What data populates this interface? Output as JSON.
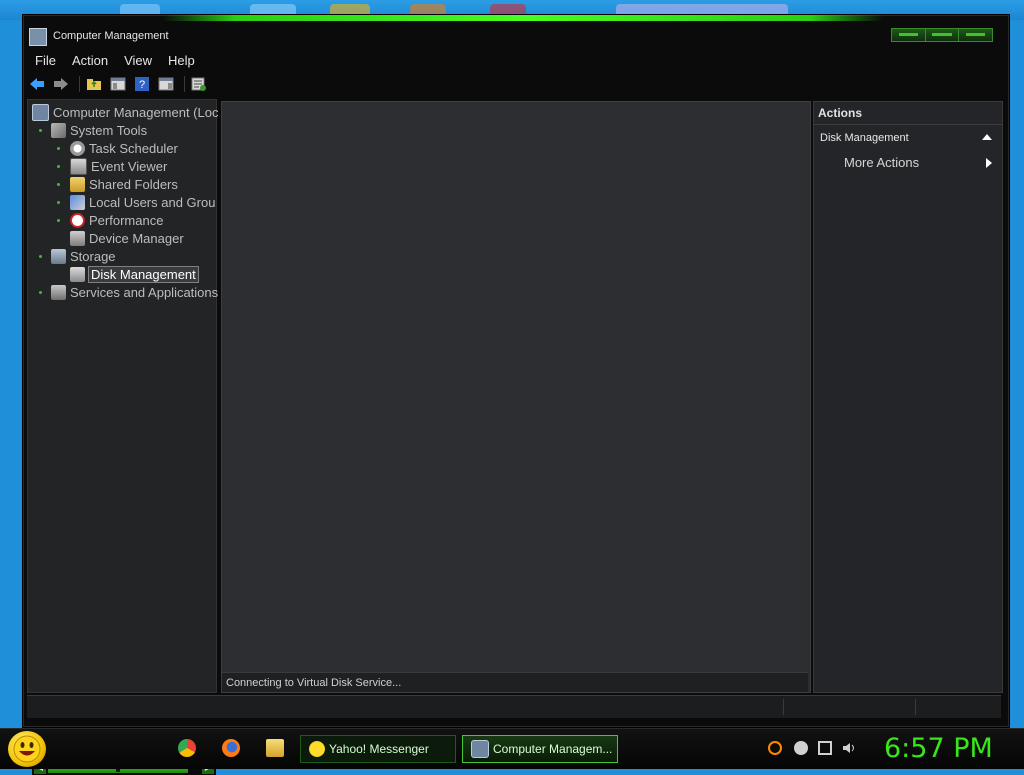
{
  "window": {
    "title": "Computer Management"
  },
  "menu": [
    "File",
    "Action",
    "View",
    "Help"
  ],
  "toolbar": {
    "icons": [
      "back-icon",
      "forward-icon",
      "up-folder-icon",
      "show-hide-tree-icon",
      "help-icon",
      "show-hide-action-pane-icon",
      "properties-icon"
    ]
  },
  "tree": {
    "items": [
      {
        "label": "Computer Management (Loc",
        "icon": "computer-management-icon"
      },
      {
        "label": "System Tools",
        "icon": "tools-icon"
      },
      {
        "label": "Task Scheduler",
        "icon": "clock-icon"
      },
      {
        "label": "Event Viewer",
        "icon": "event-viewer-icon"
      },
      {
        "label": "Shared Folders",
        "icon": "shared-folders-icon"
      },
      {
        "label": "Local Users and Grou",
        "icon": "users-icon"
      },
      {
        "label": "Performance",
        "icon": "performance-icon"
      },
      {
        "label": "Device Manager",
        "icon": "device-manager-icon"
      },
      {
        "label": "Storage",
        "icon": "storage-icon"
      },
      {
        "label": "Disk Management",
        "icon": "disk-icon"
      },
      {
        "label": "Services and Applications",
        "icon": "services-icon"
      }
    ]
  },
  "content": {
    "status": "Connecting to Virtual Disk Service..."
  },
  "actions": {
    "header": "Actions",
    "section": "Disk Management",
    "more": "More Actions"
  },
  "taskbar": {
    "tasks": [
      {
        "label": "Yahoo! Messenger"
      },
      {
        "label": "Computer Managem..."
      }
    ],
    "clock": "6:57 PM"
  },
  "colors": {
    "accent": "#39e61a",
    "tree_bg": "#232426",
    "content_bg": "#2d2e32"
  }
}
